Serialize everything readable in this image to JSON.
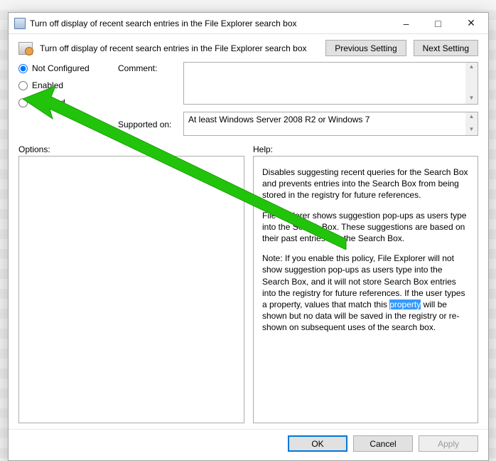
{
  "window": {
    "title": "Turn off display of recent search entries in the File Explorer search box"
  },
  "header": {
    "desc": "Turn off display of recent search entries in the File Explorer search box",
    "prev_btn": "Previous Setting",
    "next_btn": "Next Setting"
  },
  "radios": {
    "not_configured": "Not Configured",
    "enabled": "Enabled",
    "disabled": "Disabled",
    "selected": "not_configured"
  },
  "fields": {
    "comment_label": "Comment:",
    "comment_value": "",
    "supported_label": "Supported on:",
    "supported_value": "At least Windows Server 2008 R2 or Windows 7"
  },
  "sections": {
    "options_label": "Options:",
    "help_label": "Help:"
  },
  "help": {
    "p1": "Disables suggesting recent queries for the Search Box and prevents entries into the Search Box from being stored in the registry for future references.",
    "p2": "File Explorer shows suggestion pop-ups as users type into the Search Box.  These suggestions are based on their past entries into the Search Box.",
    "p3_pre": "Note: If you enable this policy, File Explorer will not show suggestion pop-ups as users type into the Search Box, and it will not store Search Box entries into the registry for future references.  If the user types a property, values that match this ",
    "p3_hl": "property",
    "p3_post": " will be shown but no data will be saved in the registry or re-shown on subsequent uses of the search box."
  },
  "buttons": {
    "ok": "OK",
    "cancel": "Cancel",
    "apply": "Apply"
  }
}
